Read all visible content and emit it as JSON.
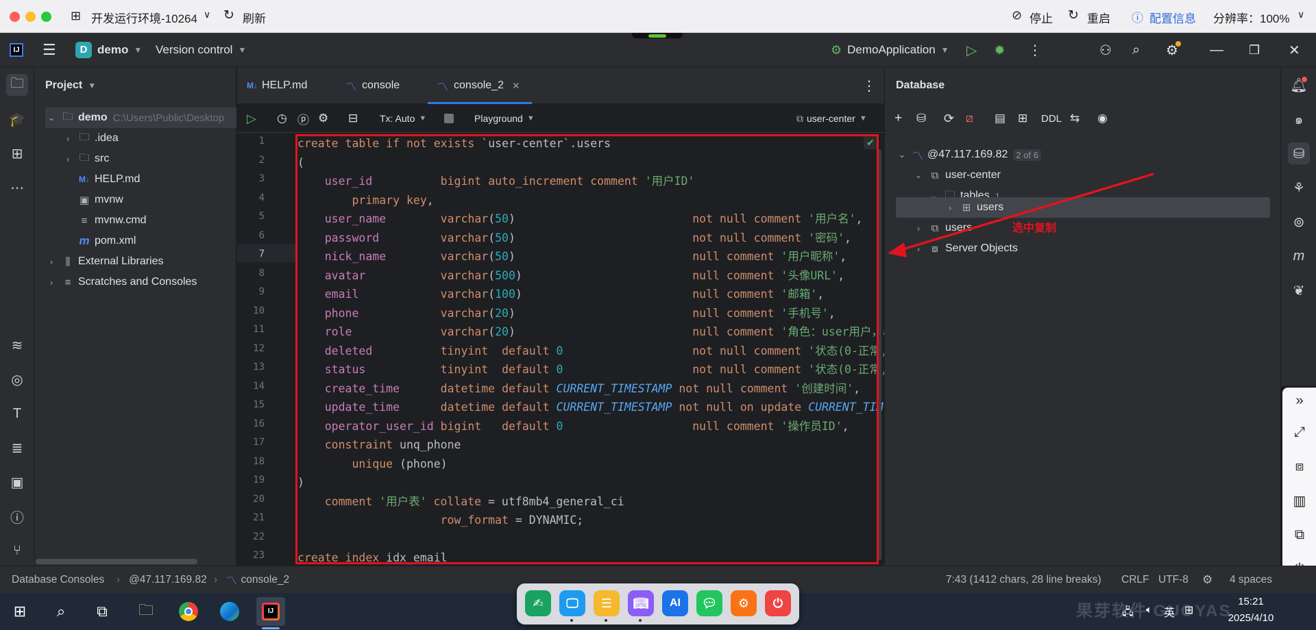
{
  "remote_bar": {
    "title": "开发运行环境-10264",
    "refresh": "刷新",
    "stop": "停止",
    "restart": "重启",
    "config": "配置信息",
    "resolution": "分辨率：100%"
  },
  "toolbar": {
    "project_badge": "D",
    "project_name": "demo",
    "vcs": "Version control",
    "run_config": "DemoApplication"
  },
  "project_panel": {
    "title": "Project",
    "root_name": "demo",
    "root_path": "C:\\Users\\Public\\Desktop",
    "items": [
      {
        "label": ".idea"
      },
      {
        "label": "src"
      },
      {
        "label": "HELP.md",
        "icon": "M↓"
      },
      {
        "label": "mvnw"
      },
      {
        "label": "mvnw.cmd"
      },
      {
        "label": "pom.xml",
        "icon": "m"
      },
      {
        "label": "External Libraries"
      },
      {
        "label": "Scratches and Consoles"
      }
    ]
  },
  "editor": {
    "tabs": [
      {
        "label": "HELP.md",
        "icon": "M↓"
      },
      {
        "label": "console"
      },
      {
        "label": "console_2"
      }
    ],
    "tx_mode": "Tx: Auto",
    "playground": "Playground",
    "schema": "user-center"
  },
  "code_lines": [
    "create table if not exists `user-center`.users",
    "(",
    "    user_id          bigint auto_increment comment '用户ID'",
    "        primary key,",
    "    user_name        varchar(50)                          not null comment '用户名',",
    "    password         varchar(50)                          not null comment '密码',",
    "    nick_name        varchar(50)                          null comment '用户昵称',",
    "    avatar           varchar(500)                         null comment '头像URL',",
    "    email            varchar(100)                         null comment '邮箱',",
    "    phone            varchar(20)                          null comment '手机号',",
    "    role             varchar(20)                          null comment '角色：user用户，ad",
    "    deleted          tinyint  default 0                   not null comment '状态(0-正常,1",
    "    status           tinyint  default 0                   not null comment '状态(0-正常,1",
    "    create_time      datetime default CURRENT_TIMESTAMP not null comment '创建时间',",
    "    update_time      datetime default CURRENT_TIMESTAMP not null on update CURRENT_TIM",
    "    operator_user_id bigint   default 0                   null comment '操作员ID',",
    "    constraint unq_phone",
    "        unique (phone)",
    ")",
    "    comment '用户表' collate = utf8mb4_general_ci",
    "                     row_format = DYNAMIC;",
    "",
    "create index idx_email"
  ],
  "line_numbers": [
    "1",
    "2",
    "3",
    "4",
    "5",
    "6",
    "7",
    "8",
    "9",
    "10",
    "11",
    "12",
    "13",
    "14",
    "15",
    "16",
    "17",
    "18",
    "19",
    "20",
    "21",
    "22",
    "23"
  ],
  "database_panel": {
    "title": "Database",
    "ddl": "DDL",
    "host": "@47.117.169.82",
    "host_badge": "2 of 6",
    "schema": "user-center",
    "tables": "tables",
    "tables_count": "1",
    "table": "users",
    "users_node": "users",
    "server_objects": "Server Objects",
    "annotation": "选中复制"
  },
  "status_bar": {
    "crumb1": "Database Consoles",
    "crumb2": "@47.117.169.82",
    "crumb3": "console_2",
    "position": "7:43 (1412 chars, 28 line breaks)",
    "line_sep": "CRLF",
    "encoding": "UTF-8",
    "indent": "4 spaces"
  },
  "taskbar": {
    "ime": "英",
    "time": "15:21",
    "date": "2025/4/10"
  },
  "colors": {
    "selection": "#214283",
    "annotation_red": "#e0141e",
    "accent": "#3574f0"
  }
}
